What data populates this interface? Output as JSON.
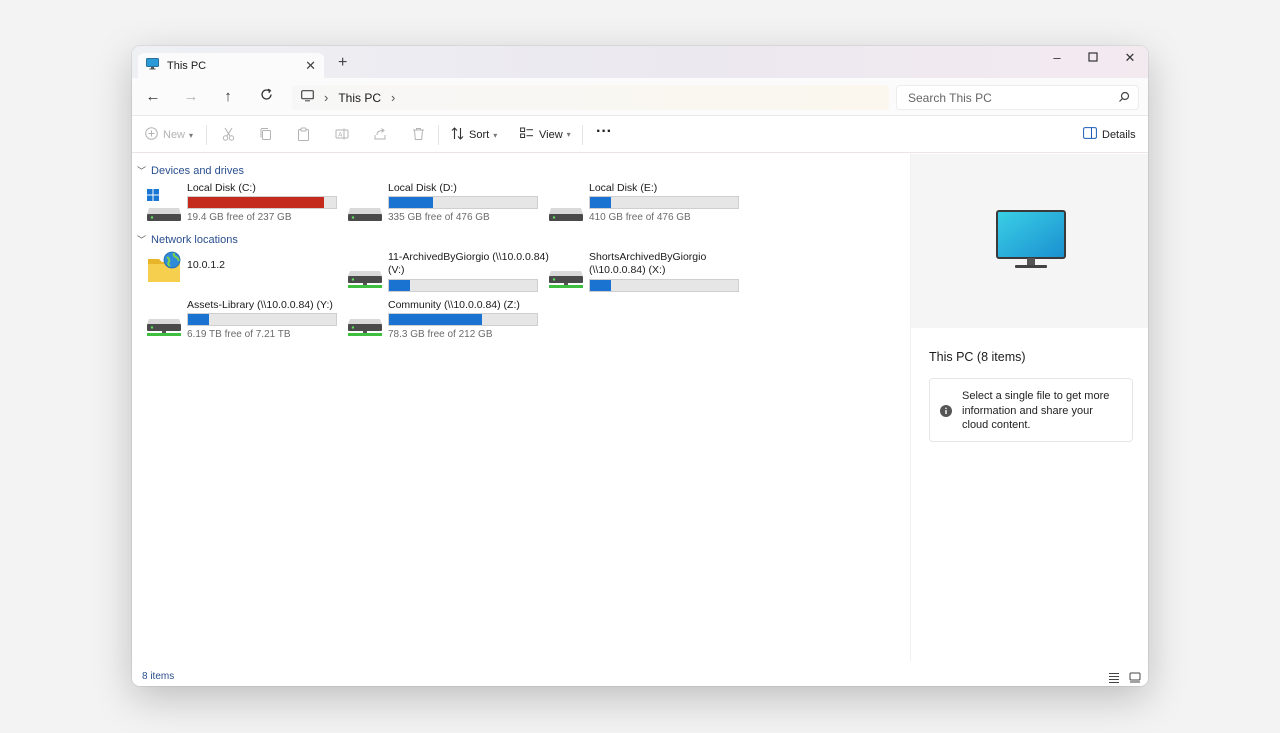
{
  "tab": {
    "title": "This PC"
  },
  "address": {
    "location": "This PC"
  },
  "search": {
    "placeholder": "Search This PC"
  },
  "toolbar": {
    "new_label": "New",
    "sort_label": "Sort",
    "view_label": "View",
    "more_label": "···",
    "details_label": "Details"
  },
  "sections": {
    "devices": "Devices and drives",
    "network": "Network locations"
  },
  "drives": [
    {
      "name": "Local Disk (C:)",
      "free": "19.4 GB free of 237 GB",
      "used_fraction": 0.92,
      "critical": true
    },
    {
      "name": "Local Disk (D:)",
      "free": "335 GB free of 476 GB",
      "used_fraction": 0.3,
      "critical": false
    },
    {
      "name": "Local Disk (E:)",
      "free": "410 GB free of 476 GB",
      "used_fraction": 0.14,
      "critical": false
    }
  ],
  "network": {
    "folder": {
      "name": "10.0.1.2"
    },
    "drives": [
      {
        "name_line1": "11-ArchivedByGiorgio (\\\\10.0.0.84)",
        "name_line2": "(V:)",
        "used_fraction": 0.14
      },
      {
        "name_line1": "ShortsArchivedByGiorgio",
        "name_line2": "(\\\\10.0.0.84) (X:)",
        "used_fraction": 0.14
      },
      {
        "name": "Assets-Library (\\\\10.0.0.84) (Y:)",
        "free": "6.19 TB free of 7.21 TB",
        "used_fraction": 0.14
      },
      {
        "name": "Community (\\\\10.0.0.84) (Z:)",
        "free": "78.3 GB free of 212 GB",
        "used_fraction": 0.63
      }
    ]
  },
  "details": {
    "title": "This PC (8 items)",
    "info": "Select a single file to get more information and share your cloud content."
  },
  "status": {
    "count": "8 items"
  },
  "colors": {
    "accent": "#1a73d1",
    "critical": "#c42b1c",
    "section": "#2a4f8e"
  }
}
